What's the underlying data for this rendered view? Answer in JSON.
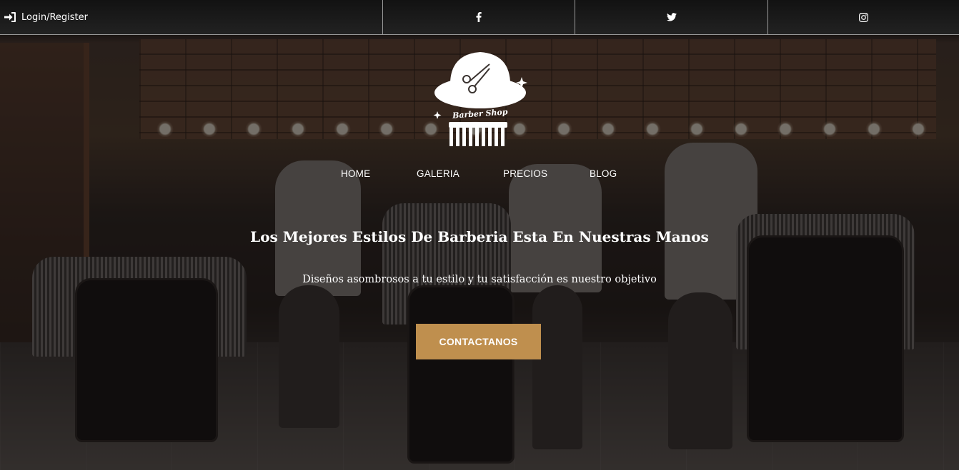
{
  "topbar": {
    "login_label": "Login/Register",
    "login_icon": "sign-in-icon",
    "social": [
      {
        "name": "facebook",
        "icon": "facebook-icon"
      },
      {
        "name": "twitter",
        "icon": "twitter-icon"
      },
      {
        "name": "instagram",
        "icon": "instagram-icon"
      }
    ]
  },
  "logo": {
    "text": "Barber Shop",
    "icon": "bowler-hat-scissors-comb-logo"
  },
  "nav": {
    "items": [
      "HOME",
      "GALERIA",
      "PRECIOS",
      "BLOG"
    ]
  },
  "hero": {
    "headline": "Los Mejores Estilos De Barberia Esta En Nuestras Manos",
    "subline": "Diseños asombrosos a tu estilo y tu satisfacción es nuestro objetivo",
    "cta_label": "CONTACTANOS"
  },
  "colors": {
    "accent": "#bf8f4e",
    "topbar_bg": "#1a1a1a",
    "overlay": "rgba(12,10,9,0.55)"
  }
}
